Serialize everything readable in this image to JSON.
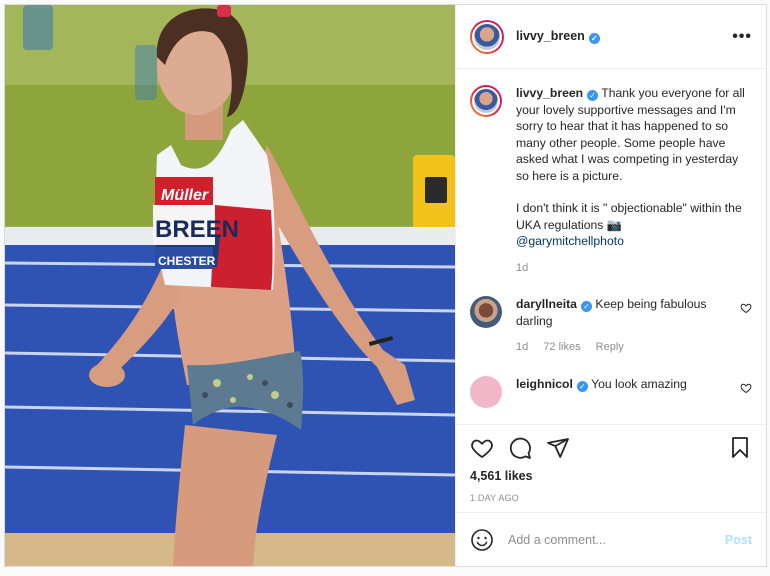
{
  "post": {
    "username": "livvy_breen",
    "more_label": "•••"
  },
  "caption": {
    "username": "livvy_breen",
    "text1": "Thank you everyone for all your lovely supportive messages and I'm sorry to hear that it has happened to so many other people. Some people have asked what I was competing in yesterday so here is a picture.",
    "text2": "I don't think it is \" objectionable\" within the UKA regulations 📷",
    "mention": "@garymitchellphoto",
    "time": "1d"
  },
  "comments": [
    {
      "username": "daryllneita",
      "text": "Keep being fabulous darling",
      "time": "1d",
      "likes": "72 likes",
      "reply": "Reply"
    },
    {
      "username": "leighnicol",
      "text": "You look amazing"
    }
  ],
  "photo": {
    "bib_brand": "Müller",
    "bib_name": "BREEN",
    "bib_city": "CHESTER"
  },
  "stats": {
    "likes": "4,561 likes",
    "ago": "1 DAY AGO"
  },
  "add_comment": {
    "placeholder": "Add a comment...",
    "post_label": "Post"
  }
}
